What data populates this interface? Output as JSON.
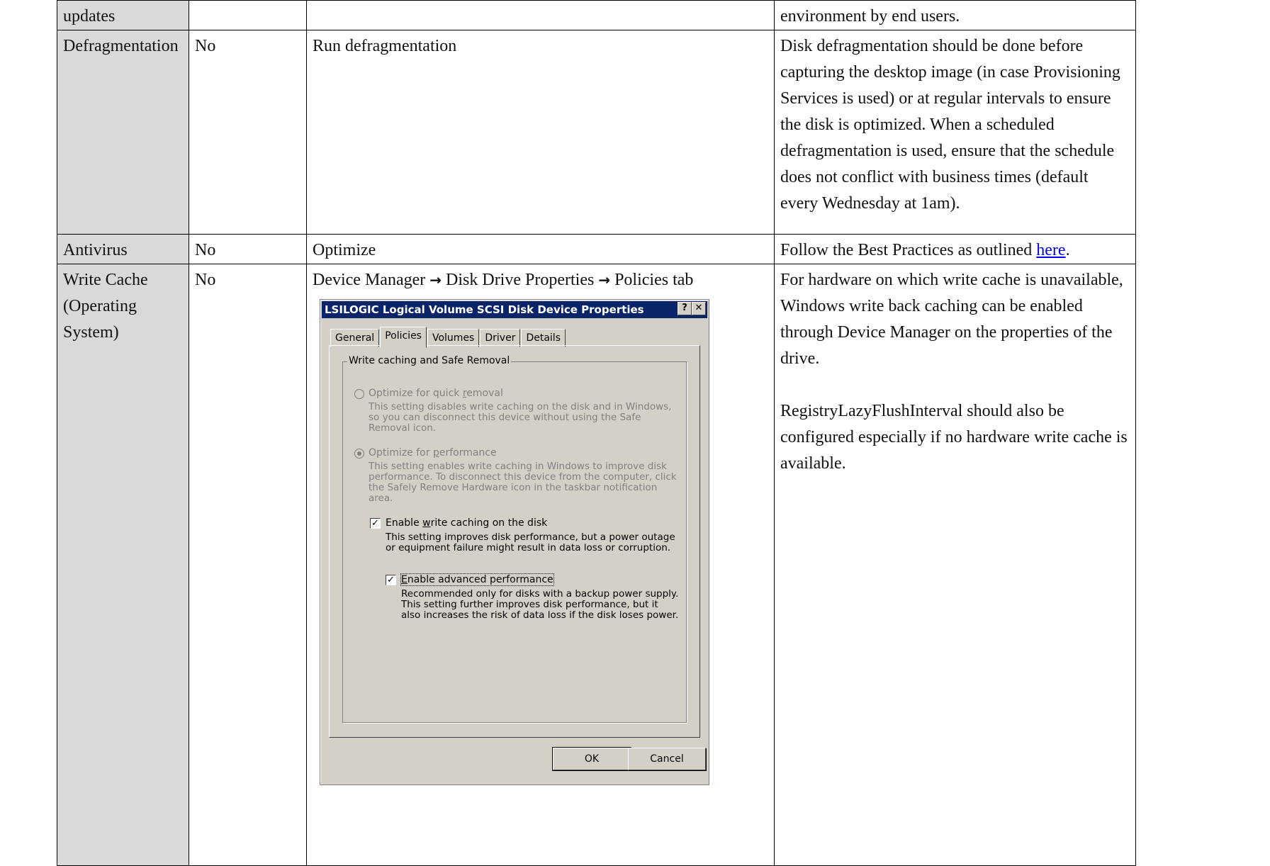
{
  "rows": [
    {
      "setting": "updates",
      "enabled": "",
      "action": "",
      "notes": "environment by end users."
    },
    {
      "setting": "Defragmentation",
      "enabled": "No",
      "action": "Run defragmentation",
      "notes": "Disk defragmentation should be done before capturing the desktop image (in case Provisioning Services is used) or at regular intervals to ensure the disk is optimized. When a scheduled defragmentation is used, ensure that the schedule does not conflict with business times (default every Wednesday at 1am)."
    },
    {
      "setting": "Antivirus",
      "enabled": "No",
      "action": "Optimize",
      "notes_prefix": "Follow the Best Practices as outlined ",
      "notes_link": "here",
      "notes_suffix": "."
    },
    {
      "setting": "Write Cache (Operating System)",
      "enabled": "No",
      "action_parts": [
        "Device Manager ",
        "→",
        " Disk Drive Properties ",
        "→",
        " Policies tab"
      ],
      "notes_p1": "For hardware on which write cache is unavailable, Windows write back caching can be enabled through Device Manager on the properties of the drive.",
      "notes_p2": "RegistryLazyFlushInterval should also be configured especially if no hardware write cache is available."
    }
  ],
  "dialog": {
    "title": "LSILOGIC Logical Volume SCSI Disk Device Properties",
    "help_button": "?",
    "close_button": "✕",
    "tabs": [
      "General",
      "Policies",
      "Volumes",
      "Driver",
      "Details"
    ],
    "active_tab": "Policies",
    "group_title": "Write caching and Safe Removal",
    "quick_removal": {
      "label_pre": "Optimize for quick ",
      "label_key": "r",
      "label_post": "emoval",
      "desc": "This setting disables write caching on the disk and in Windows, so you can disconnect this device without using the Safe Removal icon.",
      "selected": false
    },
    "performance": {
      "label_pre": "Optimize for ",
      "label_key": "p",
      "label_post": "erformance",
      "desc": "This setting enables write caching in Windows to improve disk performance. To disconnect this device from the computer, click the Safely Remove Hardware icon in the taskbar notification area.",
      "selected": true
    },
    "write_caching": {
      "label_pre": "Enable ",
      "label_key": "w",
      "label_post": "rite caching on the disk",
      "desc": "This setting improves disk performance, but a power outage or equipment failure might result in data loss or corruption.",
      "checked": true
    },
    "advanced": {
      "label_pre": "",
      "label_key": "E",
      "label_post": "nable advanced performance",
      "desc": "Recommended only for disks with a backup power supply. This setting further improves disk performance, but it also increases the risk of data loss if the disk loses power.",
      "checked": true
    },
    "ok_label": "OK",
    "cancel_label": "Cancel"
  }
}
